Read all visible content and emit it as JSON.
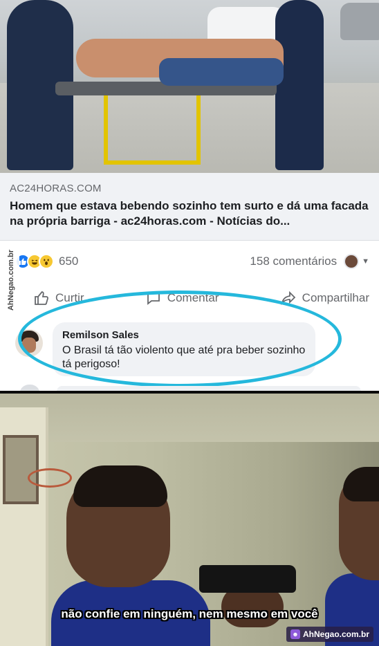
{
  "post": {
    "link_domain": "AC24HORAS.COM",
    "link_title": "Homem que estava bebendo sozinho tem surto e dá uma facada na própria barriga - ac24horas.com - Notícias do...",
    "reaction_count": "650",
    "comment_count": "158 comentários",
    "actions": {
      "like_label": "Curtir",
      "comment_label": "Comentar",
      "share_label": "Compartilhar"
    }
  },
  "comment": {
    "author": "Remilson Sales",
    "text": "O Brasil tá tão violento que até pra beber sozinho tá  perigoso!"
  },
  "highlight_color": "#25b8dc",
  "watermark": {
    "vertical_text": "AhNegao.com.br",
    "corner_text": "AhNegao.com.br"
  },
  "meme": {
    "caption": "não confie em ninguém, nem mesmo em você"
  }
}
